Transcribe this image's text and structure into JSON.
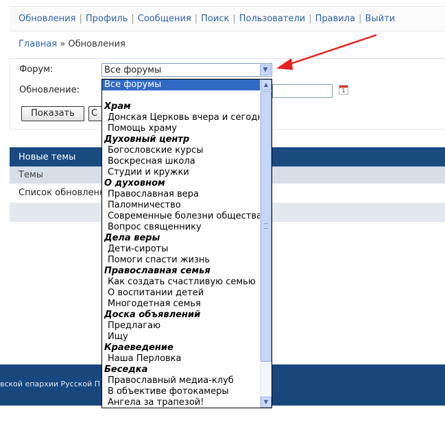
{
  "nav": {
    "links": [
      "Обновления",
      "Профиль",
      "Сообщения",
      "Поиск",
      "Пользователи",
      "Правила",
      "Выйти"
    ],
    "separator": "|"
  },
  "breadcrumb": {
    "home": "Главная",
    "sep": "»",
    "current": "Обновления"
  },
  "form": {
    "forum_label": "Форум:",
    "update_label": "Обновление:",
    "select_value": "Все форумы",
    "show_button": "Показать",
    "second_button": "С",
    "calendar_day": "1"
  },
  "table": {
    "header": "Новые темы",
    "subheader": "Темы",
    "row_text": "Список обновленн"
  },
  "footer": {
    "text": "вской епархии Русской П"
  },
  "dropdown": {
    "options": [
      {
        "label": "Все форумы",
        "type": "top",
        "selected": true
      },
      {
        "label": "",
        "type": "blank"
      },
      {
        "label": "Храм",
        "type": "group"
      },
      {
        "label": "Донская Церковь вчера и сегодня",
        "type": "child"
      },
      {
        "label": "Помощь храму",
        "type": "child"
      },
      {
        "label": "Духовный центр",
        "type": "group"
      },
      {
        "label": "Богословские курсы",
        "type": "child"
      },
      {
        "label": "Воскресная школа",
        "type": "child"
      },
      {
        "label": "Студии и кружки",
        "type": "child"
      },
      {
        "label": "О духовном",
        "type": "group"
      },
      {
        "label": "Православная вера",
        "type": "child"
      },
      {
        "label": "Паломничество",
        "type": "child"
      },
      {
        "label": "Современные болезни общества",
        "type": "child"
      },
      {
        "label": "Вопрос священнику",
        "type": "child"
      },
      {
        "label": "Дела веры",
        "type": "group"
      },
      {
        "label": "Дети-сироты",
        "type": "child"
      },
      {
        "label": "Помоги спасти жизнь",
        "type": "child"
      },
      {
        "label": "Православная семья",
        "type": "group"
      },
      {
        "label": "Как создать счастливую семью",
        "type": "child"
      },
      {
        "label": "О воспитании детей",
        "type": "child"
      },
      {
        "label": "Многодетная семья",
        "type": "child"
      },
      {
        "label": "Доска объявлений",
        "type": "group"
      },
      {
        "label": "Предлагаю",
        "type": "child"
      },
      {
        "label": "Ищу",
        "type": "child"
      },
      {
        "label": "Краеведение",
        "type": "group"
      },
      {
        "label": "Наша Перловка",
        "type": "child"
      },
      {
        "label": "Беседка",
        "type": "group"
      },
      {
        "label": "Православный медиа-клуб",
        "type": "child"
      },
      {
        "label": "В объективе фотокамеры",
        "type": "child"
      },
      {
        "label": "Ангела за трапезой!",
        "type": "child"
      }
    ]
  },
  "colors": {
    "link": "#2d63a6",
    "table_header": "#194a80",
    "selection": "#316ac5",
    "annotation_arrow": "#e8201f"
  }
}
